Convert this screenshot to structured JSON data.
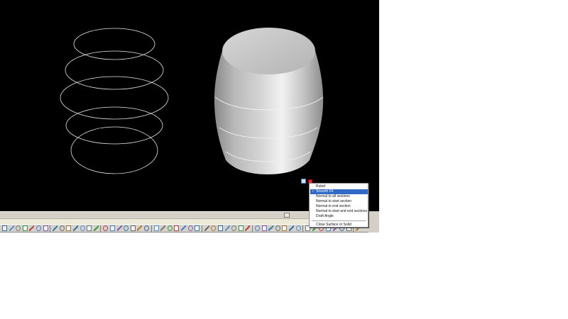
{
  "viewport": {
    "background": "#000000",
    "wire_color": "#e6e6e6",
    "solid_color": "#c4c4c4"
  },
  "context_menu": {
    "items": [
      {
        "label": "Ruled",
        "selected": false,
        "checked": false
      },
      {
        "label": "Smooth Fit",
        "selected": true,
        "checked": true
      },
      {
        "label": "Normal to all sections",
        "selected": false,
        "checked": false
      },
      {
        "label": "Normal to start section",
        "selected": false,
        "checked": false
      },
      {
        "label": "Normal to end section",
        "selected": false,
        "checked": false
      },
      {
        "label": "Normal to start and end sections",
        "selected": false,
        "checked": false
      },
      {
        "label": "Draft Angle",
        "selected": false,
        "checked": false
      }
    ],
    "footer_item": {
      "label": "Close Surface or Solid"
    },
    "check_glyph": "✓",
    "highlight_color": "#3169c6"
  },
  "grips": {
    "loft_grip_icon": "loft-menu-grip-icon",
    "close_grip_icon": "red-grip-icon"
  },
  "toolbar": {
    "icons": [
      "undo-icon",
      "redo-icon",
      "pan-icon",
      "zoom-icon",
      "orbit-icon",
      "box-icon",
      "wedge-icon",
      "cone-icon",
      "sphere-icon",
      "cylinder-icon",
      "torus-icon",
      "pyramid-icon",
      "extrude-icon",
      "loft-icon",
      "union-icon",
      "subtract-icon",
      "intersect-icon",
      "line-icon",
      "polyline-icon",
      "circle-icon",
      "arc-icon",
      "rectangle-icon",
      "move-icon",
      "copy-icon",
      "rotate-icon",
      "mirror-icon",
      "offset-icon",
      "trim-icon",
      "extend-icon",
      "fillet-icon",
      "chamfer-icon",
      "explode-icon",
      "text-icon",
      "dimension-icon",
      "hatch-icon",
      "layer-icon",
      "properties-icon",
      "match-icon",
      "ucs-icon",
      "view-icon",
      "render-icon",
      "shade-icon",
      "visual-style-icon",
      "lights-icon",
      "materials-icon",
      "camera-icon",
      "walk-icon",
      "fly-icon",
      "section-icon",
      "flatten-icon"
    ]
  }
}
